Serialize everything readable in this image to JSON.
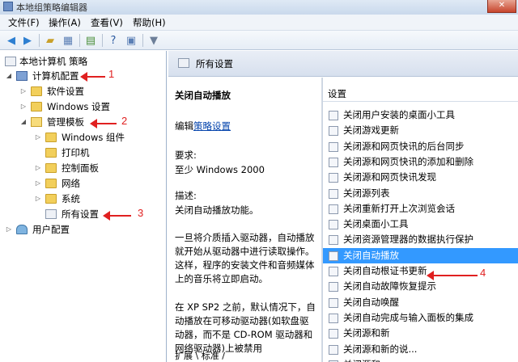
{
  "window": {
    "title": "本地组策略编辑器",
    "close_label": "✕"
  },
  "menu": [
    "文件(F)",
    "操作(A)",
    "查看(V)",
    "帮助(H)"
  ],
  "tree": {
    "root": "本地计算机 策略",
    "computer_config": "计算机配置",
    "software_settings": "软件设置",
    "windows_settings": "Windows 设置",
    "admin_templates": "管理模板",
    "windows_components": "Windows 组件",
    "printers": "打印机",
    "control_panel": "控制面板",
    "network": "网络",
    "system": "系统",
    "all_settings": "所有设置",
    "user_config": "用户配置"
  },
  "annotations": [
    "1",
    "2",
    "3",
    "4"
  ],
  "right_header": "所有设置",
  "description": {
    "title": "关闭自动播放",
    "edit_prefix": "编辑",
    "edit_link": "策略设置",
    "requires_label": "要求:",
    "requires_value": "至少 Windows 2000",
    "desc_label": "描述:",
    "desc_1": "关闭自动播放功能。",
    "desc_2": "一旦将介质插入驱动器，自动播放就开始从驱动器中进行读取操作。这样，程序的安装文件和音频媒体上的音乐将立即启动。",
    "desc_3": "在 XP SP2 之前，默认情况下，自动播放在可移动驱动器(如软盘驱动器，而不是 CD-ROM 驱动器和网络驱动器)上被禁用",
    "tabs": "扩展 \\ 标准 /"
  },
  "list": {
    "header": "设置",
    "items": [
      "关闭用户安装的桌面小工具",
      "关闭游戏更新",
      "关闭源和网页快讯的后台同步",
      "关闭源和网页快讯的添加和删除",
      "关闭源和网页快讯发现",
      "关闭源列表",
      "关闭重新打开上次浏览会话",
      "关闭桌面小工具",
      "关闭资源管理器的数据执行保护",
      "关闭自动播放",
      "关闭自动根证书更新",
      "关闭自动故障恢复提示",
      "关闭自动唤醒",
      "关闭自动完成与输入面板的集成",
      "关闭源和新",
      "关闭源和新的说...",
      "关闭源和..."
    ],
    "selected_index": 9
  },
  "colors": {
    "selection": "#3399ff",
    "annotation": "#e02020",
    "link": "#0645ad"
  }
}
